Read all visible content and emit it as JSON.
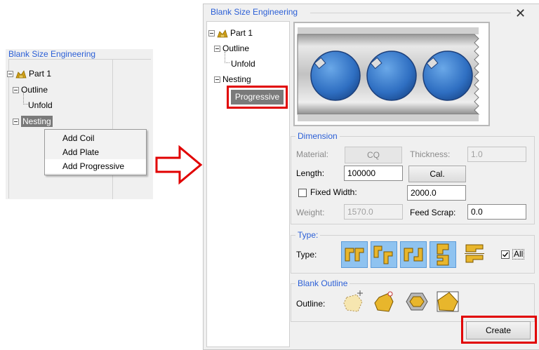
{
  "left": {
    "group_title": "Blank Size Engineering",
    "tree": {
      "part": "Part 1",
      "outline": "Outline",
      "unfold": "Unfold",
      "nesting": "Nesting"
    },
    "context_menu": [
      "Add Coil",
      "Add Plate",
      "Add Progressive"
    ]
  },
  "dialog": {
    "title": "Blank Size Engineering",
    "close_glyph": "✕",
    "tree": {
      "part": "Part 1",
      "outline": "Outline",
      "unfold": "Unfold",
      "nesting": "Nesting",
      "progressive": "Progressive"
    },
    "dimension": {
      "legend": "Dimension",
      "material_label": "Material:",
      "material_value": "CQ",
      "thickness_label": "Thickness:",
      "thickness_value": "1.0",
      "length_label": "Length:",
      "length_value": "100000",
      "cal_label": "Cal.",
      "fixed_width_label": "Fixed Width:",
      "fixed_width_value": "2000.0",
      "weight_label": "Weight:",
      "weight_value": "1570.0",
      "feed_scrap_label": "Feed Scrap:",
      "feed_scrap_value": "0.0"
    },
    "type": {
      "legend": "Type:",
      "label": "Type:",
      "all_label": "All"
    },
    "blank_outline": {
      "legend": "Blank Outline",
      "label": "Outline:"
    },
    "create_label": "Create"
  },
  "colors": {
    "accent": "#2b5fd6",
    "highlight": "#e10000",
    "type_selected": "#8fc3f0"
  }
}
